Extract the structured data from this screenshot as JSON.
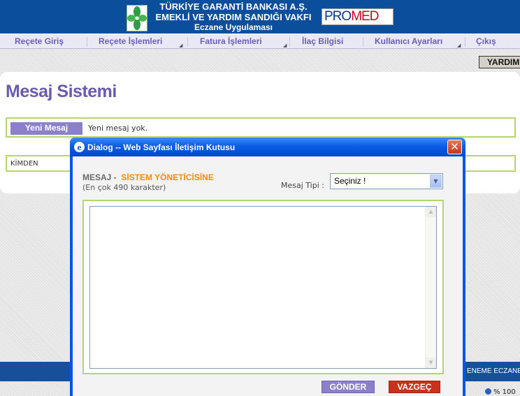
{
  "header": {
    "line1": "TÜRKİYE GARANTİ BANKASI A.Ş.",
    "line2": "EMEKLİ VE YARDIM SANDIĞI VAKFI",
    "line3": "Eczane Uygulaması",
    "partner_logo": {
      "part1": "PRO",
      "part2": "MED"
    }
  },
  "menu": {
    "items": [
      {
        "label": "Reçete Giriş",
        "has_submenu": false
      },
      {
        "label": "Reçete İşlemleri",
        "has_submenu": true
      },
      {
        "label": "Fatura İşlemleri",
        "has_submenu": true
      },
      {
        "label": "İlaç Bilgisi",
        "has_submenu": false
      },
      {
        "label": "Kullanıcı Ayarları",
        "has_submenu": true
      },
      {
        "label": "Çıkış",
        "has_submenu": false
      }
    ]
  },
  "help_button": "YARDIM",
  "page": {
    "title": "Mesaj Sistemi",
    "new_message_button": "Yeni Mesaj",
    "new_message_status": "Yeni mesaj yok.",
    "table_header_from": "KİMDEN"
  },
  "status_bar": {
    "text": "ENEME ECZANESİ",
    "zoom": "% 100"
  },
  "dialog": {
    "title": "Dialog -- Web Sayfası İletişim Kutusu",
    "message_label": "MESAJ -",
    "recipient": "SİSTEM YÖNETİCİSİNE",
    "limit_note": "(En çok 490 karakter)",
    "type_label": "Mesaj Tipi :",
    "type_selected": "Seçiniz !",
    "message_text": "",
    "send_label": "GÖNDER",
    "cancel_label": "VAZGEÇ"
  },
  "colors": {
    "header_blue": "#0b4f9c",
    "menu_text": "#6b5fb5",
    "title_purple": "#6b5ab0",
    "frame_green": "#b4d76a",
    "accent_orange": "#ff8a00",
    "cancel_red": "#c8311b",
    "dialog_blue": "#0854e3"
  },
  "icons": {
    "bank_logo": "green-clover-logo-icon",
    "dialog_icon": "internet-explorer-icon",
    "close": "close-icon",
    "select_arrow": "chevron-down-icon",
    "zoom": "globe-icon"
  }
}
